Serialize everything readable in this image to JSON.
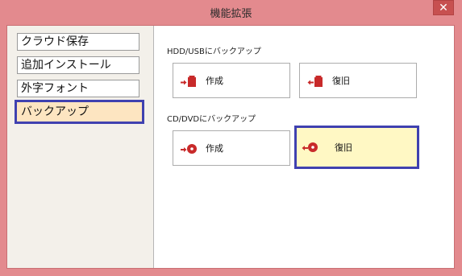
{
  "window": {
    "title": "機能拡張",
    "close_label": "✕"
  },
  "sidebar": {
    "items": [
      {
        "label": "クラウド保存"
      },
      {
        "label": "追加インストール"
      },
      {
        "label": "外字フォント"
      },
      {
        "label": "バックアップ",
        "selected": true
      }
    ]
  },
  "main": {
    "hdd_section": {
      "label": "HDD/USBにバックアップ",
      "create_label": "作成",
      "restore_label": "復旧"
    },
    "cd_section": {
      "label": "CD/DVDにバックアップ",
      "create_label": "作成",
      "restore_label": "復旧"
    }
  },
  "colors": {
    "frame": "#e38a8e",
    "highlight_border": "#3f41b0",
    "selected_bg": "#fde5c1",
    "highlight_bg": "#fff8c4",
    "icon_red": "#c82a2a"
  },
  "icons": {
    "hdd_create": "export-drive-icon",
    "hdd_restore": "import-drive-icon",
    "cd_create": "export-disc-icon",
    "cd_restore": "import-disc-icon"
  }
}
